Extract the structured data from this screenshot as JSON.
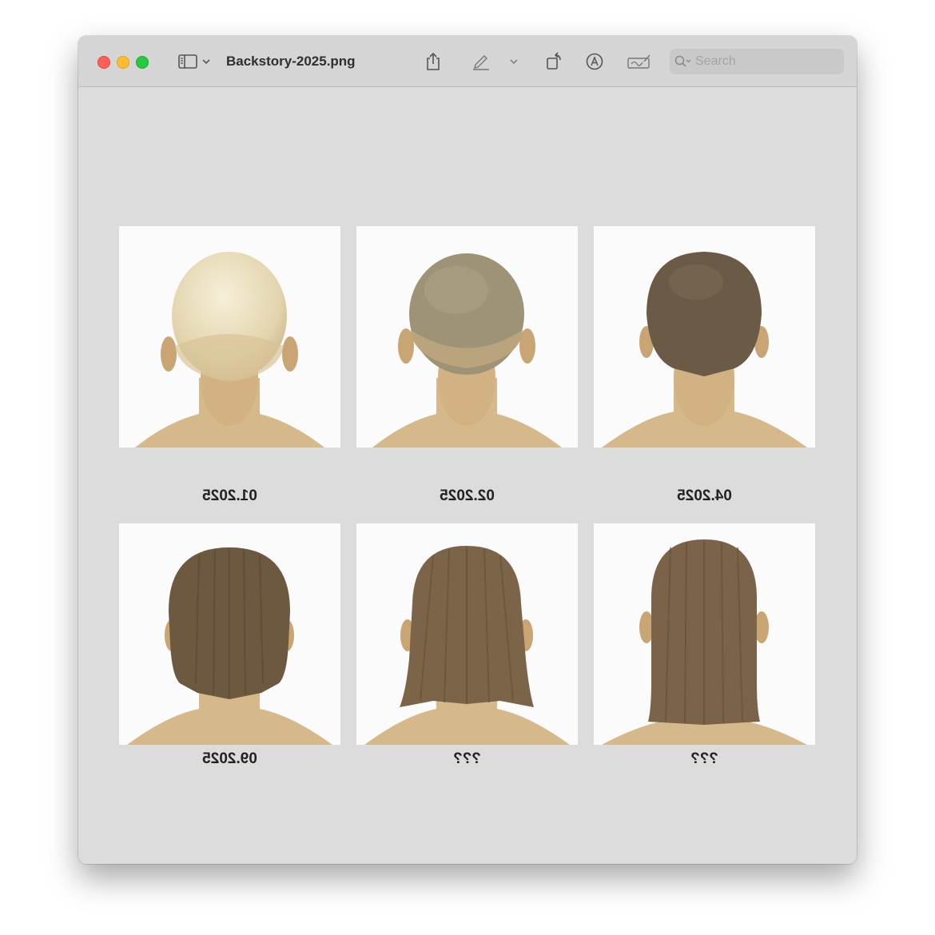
{
  "window": {
    "title": "Backstory-2025.png"
  },
  "toolbar": {
    "sidebar_toggle_icon": "sidebar-icon",
    "share_icon": "share-icon",
    "markup_icon": "pencil-icon",
    "rotate_icon": "rotate-icon",
    "annotate_icon": "annotate-icon",
    "sign_icon": "signature-icon"
  },
  "search": {
    "placeholder": "Search"
  },
  "colors": {
    "close": "#fe5f57",
    "minimize": "#febc2e",
    "maximize": "#28c840",
    "canvas": "#dcdcdc"
  },
  "grid": {
    "items": [
      {
        "caption": "01.2025",
        "hair": "bald"
      },
      {
        "caption": "02.2025",
        "hair": "buzz"
      },
      {
        "caption": "04.2025",
        "hair": "short"
      },
      {
        "caption": "09.2025",
        "hair": "ear-length"
      },
      {
        "caption": "???",
        "hair": "shoulder"
      },
      {
        "caption": "???",
        "hair": "long"
      }
    ]
  }
}
